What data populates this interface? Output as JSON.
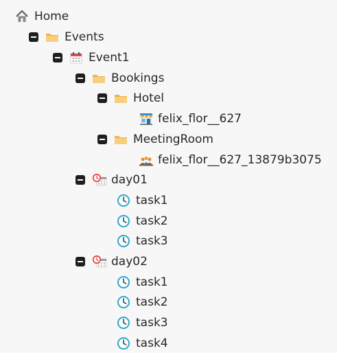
{
  "tree": {
    "home": {
      "label": "Home",
      "icon": "home-icon"
    },
    "events": {
      "label": "Events",
      "icon": "folder-icon"
    },
    "event1": {
      "label": "Event1",
      "icon": "calendar-icon"
    },
    "bookings": {
      "label": "Bookings",
      "icon": "folder-icon"
    },
    "hotel": {
      "label": "Hotel",
      "icon": "folder-icon"
    },
    "hotel_item": {
      "label": "felix_flor__627",
      "icon": "shop-icon"
    },
    "meetingroom": {
      "label": "MeetingRoom",
      "icon": "folder-icon"
    },
    "meetingroom_item": {
      "label": "felix_flor__627_13879b3075",
      "icon": "people-icon"
    },
    "day01": {
      "label": "day01",
      "icon": "day-calendar-icon",
      "tasks": [
        {
          "label": "task1",
          "icon": "clock-icon"
        },
        {
          "label": "task2",
          "icon": "clock-icon"
        },
        {
          "label": "task3",
          "icon": "clock-icon"
        }
      ]
    },
    "day02": {
      "label": "day02",
      "icon": "day-calendar-icon",
      "tasks": [
        {
          "label": "task1",
          "icon": "clock-icon"
        },
        {
          "label": "task2",
          "icon": "clock-icon"
        },
        {
          "label": "task3",
          "icon": "clock-icon"
        },
        {
          "label": "task4",
          "icon": "clock-icon"
        }
      ]
    }
  },
  "colors": {
    "folder": "#f5c16c",
    "toggle": "#1e1e1e",
    "clock": "#2fa7c9",
    "calendar_red": "#e34b4b"
  }
}
